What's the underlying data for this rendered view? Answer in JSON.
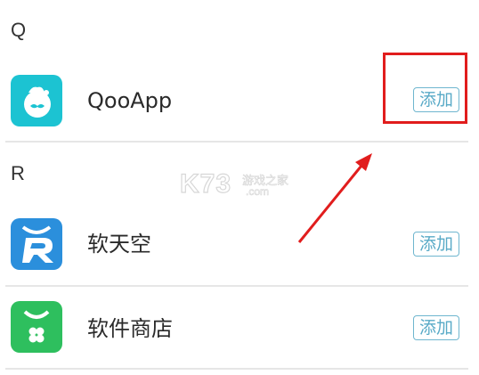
{
  "sections": [
    {
      "header": "Q",
      "apps": [
        {
          "name": "QooApp",
          "action_label": "添加",
          "icon": "qooapp-icon",
          "icon_color": "#1cc3d2"
        }
      ]
    },
    {
      "header": "R",
      "apps": [
        {
          "name": "软天空",
          "action_label": "添加",
          "icon": "ruantiankong-icon",
          "icon_color": "#2b8fdc"
        },
        {
          "name": "软件商店",
          "action_label": "添加",
          "icon": "software-store-icon",
          "icon_color": "#2ebf5e"
        }
      ]
    }
  ],
  "annotation": {
    "highlight_color": "#e11d1d",
    "highlights": "sections.0.apps.0.action_label"
  },
  "watermark": {
    "main": "K73",
    "cn": "游戏之家",
    "domain": ".com"
  },
  "colors": {
    "accent": "#59aac7",
    "divider": "#e6e6e6"
  }
}
